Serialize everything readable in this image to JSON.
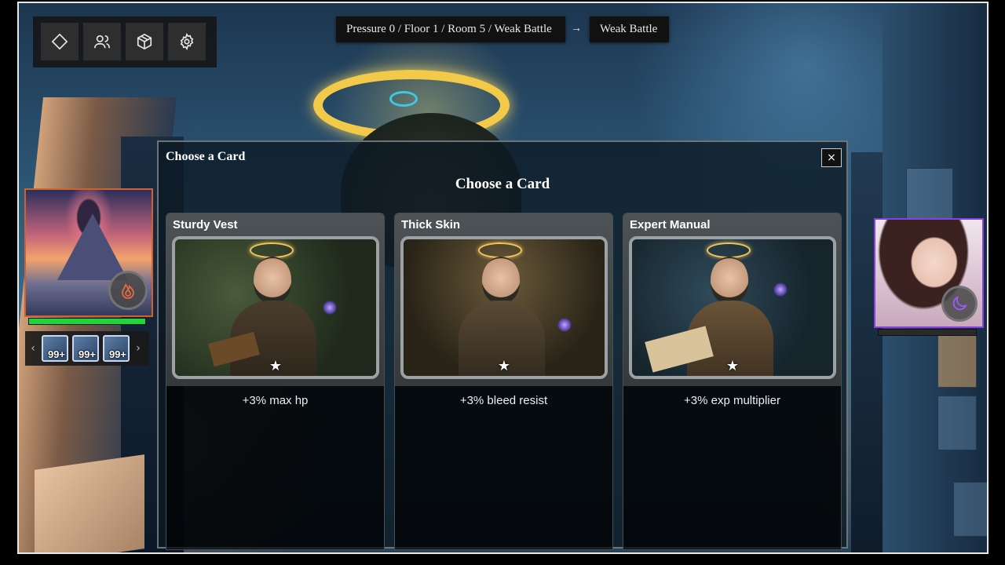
{
  "toolbar": {
    "buttons": [
      {
        "icon": "diamond-icon"
      },
      {
        "icon": "users-icon"
      },
      {
        "icon": "box-icon"
      },
      {
        "icon": "gear-icon"
      }
    ]
  },
  "breadcrumb": {
    "path": "Pressure 0 / Floor 1 / Room 5 / Weak Battle",
    "arrow": "→",
    "target": "Weak Battle"
  },
  "party": {
    "left": {
      "element_icon": "flame-icon",
      "accent": "#d1602f",
      "hp_fraction": 1.0
    },
    "right": {
      "element_icon": "moon-icon",
      "accent": "#8c3fe0",
      "hp_fraction": 0.0
    }
  },
  "items": {
    "prev": "‹",
    "next": "›",
    "slots": [
      {
        "count": "99+"
      },
      {
        "count": "99+"
      },
      {
        "count": "99+"
      }
    ]
  },
  "modal": {
    "title": "Choose a Card",
    "close_label": "×",
    "heading": "Choose a Card",
    "cards": [
      {
        "name": "Sturdy Vest",
        "star": "★",
        "description": "+3% max hp"
      },
      {
        "name": "Thick Skin",
        "star": "★",
        "description": "+3% bleed resist"
      },
      {
        "name": "Expert Manual",
        "star": "★",
        "description": "+3% exp multiplier"
      }
    ]
  }
}
